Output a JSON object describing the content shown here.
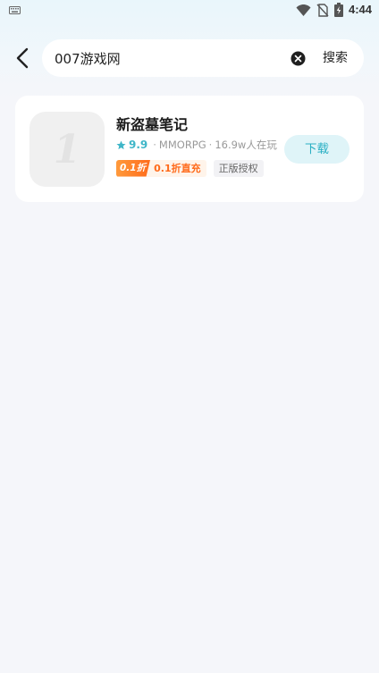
{
  "status_bar": {
    "time": "4:44",
    "icons": [
      "keyboard-icon",
      "wifi-icon",
      "no-sim-icon",
      "battery-charging-icon"
    ]
  },
  "search": {
    "query": "007游戏网",
    "clear_icon": "clear-icon",
    "button_label": "搜索",
    "back_icon": "back-arrow-icon"
  },
  "results": [
    {
      "title": "新盗墓笔记",
      "icon_glyph": "1",
      "rating": "9.9",
      "genre": "MMORPG",
      "players": "16.9w人在玩",
      "promo_badge": "0.1折",
      "promo_text": "0.1折直充",
      "license_tag": "正版授权",
      "download_label": "下载"
    }
  ],
  "colors": {
    "accent": "#2bb0c4",
    "rating": "#3fb6c8",
    "promo": "#ff6a1a",
    "background": "#f5f6fa"
  }
}
